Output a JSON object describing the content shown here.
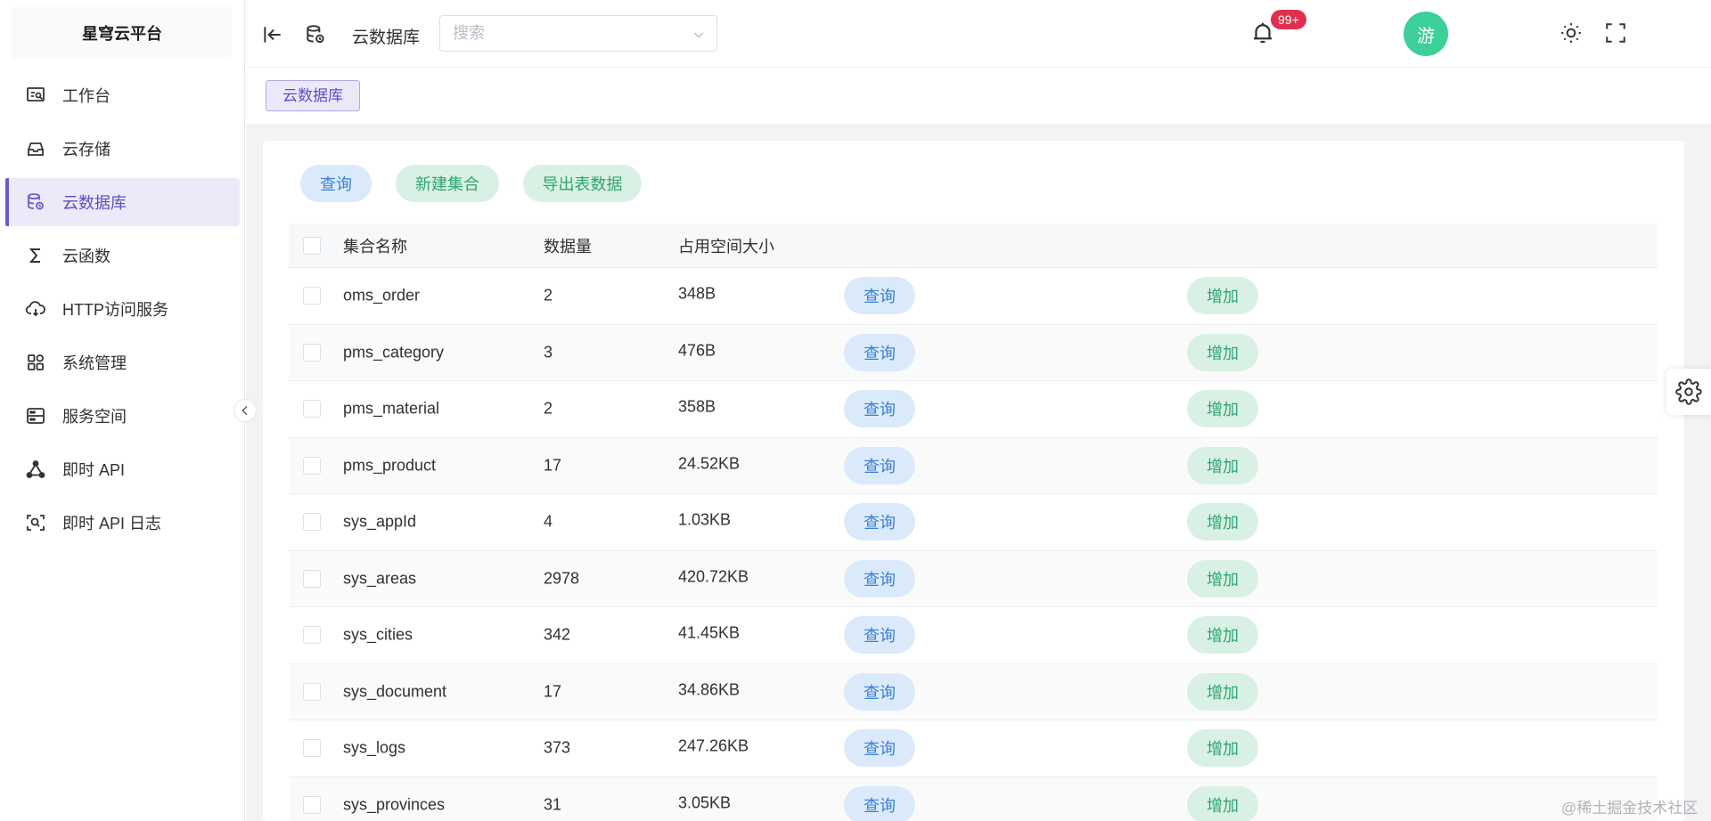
{
  "sidebar": {
    "logo": "星穹云平台",
    "items": [
      {
        "label": "工作台",
        "icon": "dashboard-icon"
      },
      {
        "label": "云存储",
        "icon": "inbox-icon"
      },
      {
        "label": "云数据库",
        "icon": "database-icon",
        "active": true
      },
      {
        "label": "云函数",
        "icon": "sigma-icon"
      },
      {
        "label": "HTTP访问服务",
        "icon": "cloud-icon"
      },
      {
        "label": "系统管理",
        "icon": "grid-icon"
      },
      {
        "label": "服务空间",
        "icon": "server-icon"
      },
      {
        "label": "即时 API",
        "icon": "share-nodes-icon"
      },
      {
        "label": "即时 API 日志",
        "icon": "scan-search-icon"
      }
    ]
  },
  "header": {
    "title": "云数据库",
    "search_placeholder": "搜索",
    "notification_badge": "99+",
    "avatar_text": "游"
  },
  "breadcrumb": {
    "tag": "云数据库"
  },
  "toolbar": {
    "query_label": "查询",
    "new_collection_label": "新建集合",
    "export_label": "导出表数据"
  },
  "table": {
    "headers": {
      "name": "集合名称",
      "count": "数据量",
      "size": "占用空间大小"
    },
    "query_btn": "查询",
    "add_btn": "增加",
    "rows": [
      {
        "name": "oms_order",
        "count": "2",
        "size": "348B"
      },
      {
        "name": "pms_category",
        "count": "3",
        "size": "476B"
      },
      {
        "name": "pms_material",
        "count": "2",
        "size": "358B"
      },
      {
        "name": "pms_product",
        "count": "17",
        "size": "24.52KB"
      },
      {
        "name": "sys_appId",
        "count": "4",
        "size": "1.03KB"
      },
      {
        "name": "sys_areas",
        "count": "2978",
        "size": "420.72KB"
      },
      {
        "name": "sys_cities",
        "count": "342",
        "size": "41.45KB"
      },
      {
        "name": "sys_document",
        "count": "17",
        "size": "34.86KB"
      },
      {
        "name": "sys_logs",
        "count": "373",
        "size": "247.26KB"
      },
      {
        "name": "sys_provinces",
        "count": "31",
        "size": "3.05KB"
      }
    ]
  },
  "watermark": "@稀土掘金技术社区",
  "colors": {
    "accent": "#6a5acd",
    "query_bg": "#dbeafb",
    "query_text": "#3a7fd5",
    "add_bg": "#d9f1e5",
    "add_text": "#2ea56f",
    "avatar_bg": "#3ccf98",
    "badge_bg": "#e0304f"
  }
}
